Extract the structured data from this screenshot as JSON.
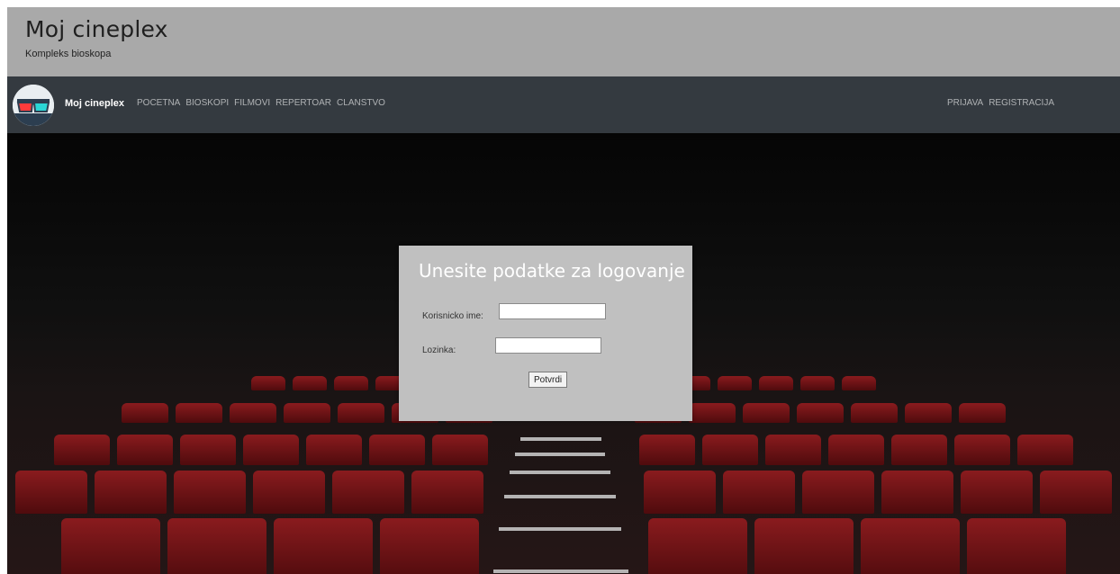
{
  "header": {
    "title": "Moj cineplex",
    "subtitle": "Kompleks bioskopa"
  },
  "navbar": {
    "brand": "Moj cineplex",
    "left_links": [
      "POCETNA",
      "BIOSKOPI",
      "FILMOVI",
      "REPERTOAR",
      "CLANSTVO"
    ],
    "right_links": [
      "PRIJAVA",
      "REGISTRACIJA"
    ],
    "logo_icon": "3d-glasses-icon"
  },
  "login": {
    "title": "Unesite podatke za logovanje",
    "username_label": "Korisnicko ime:",
    "username_value": "",
    "password_label": "Lozinka:",
    "password_value": "",
    "submit_label": "Potvrdi"
  },
  "colors": {
    "header_bg": "#a9a9a9",
    "navbar_bg": "#343a40",
    "login_box_bg": "#c0c0c0",
    "seat_red": "#8a1b1e"
  }
}
